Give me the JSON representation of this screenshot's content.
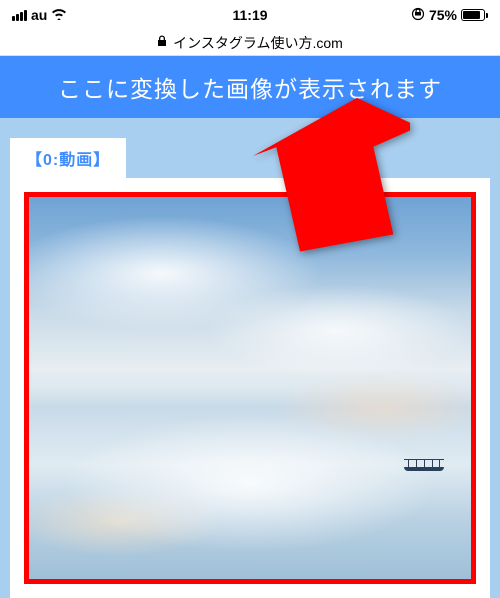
{
  "status_bar": {
    "carrier": "au",
    "time": "11:19",
    "battery_percent": "75%"
  },
  "url_bar": {
    "domain": "インスタグラム使い方.com"
  },
  "header": {
    "banner_text": "ここに変換した画像が表示されます"
  },
  "content": {
    "tab_label": "【0:動画】"
  },
  "colors": {
    "accent_blue": "#3f8dfe",
    "bg_blue": "#a8cef0",
    "highlight_red": "#ff0000"
  }
}
